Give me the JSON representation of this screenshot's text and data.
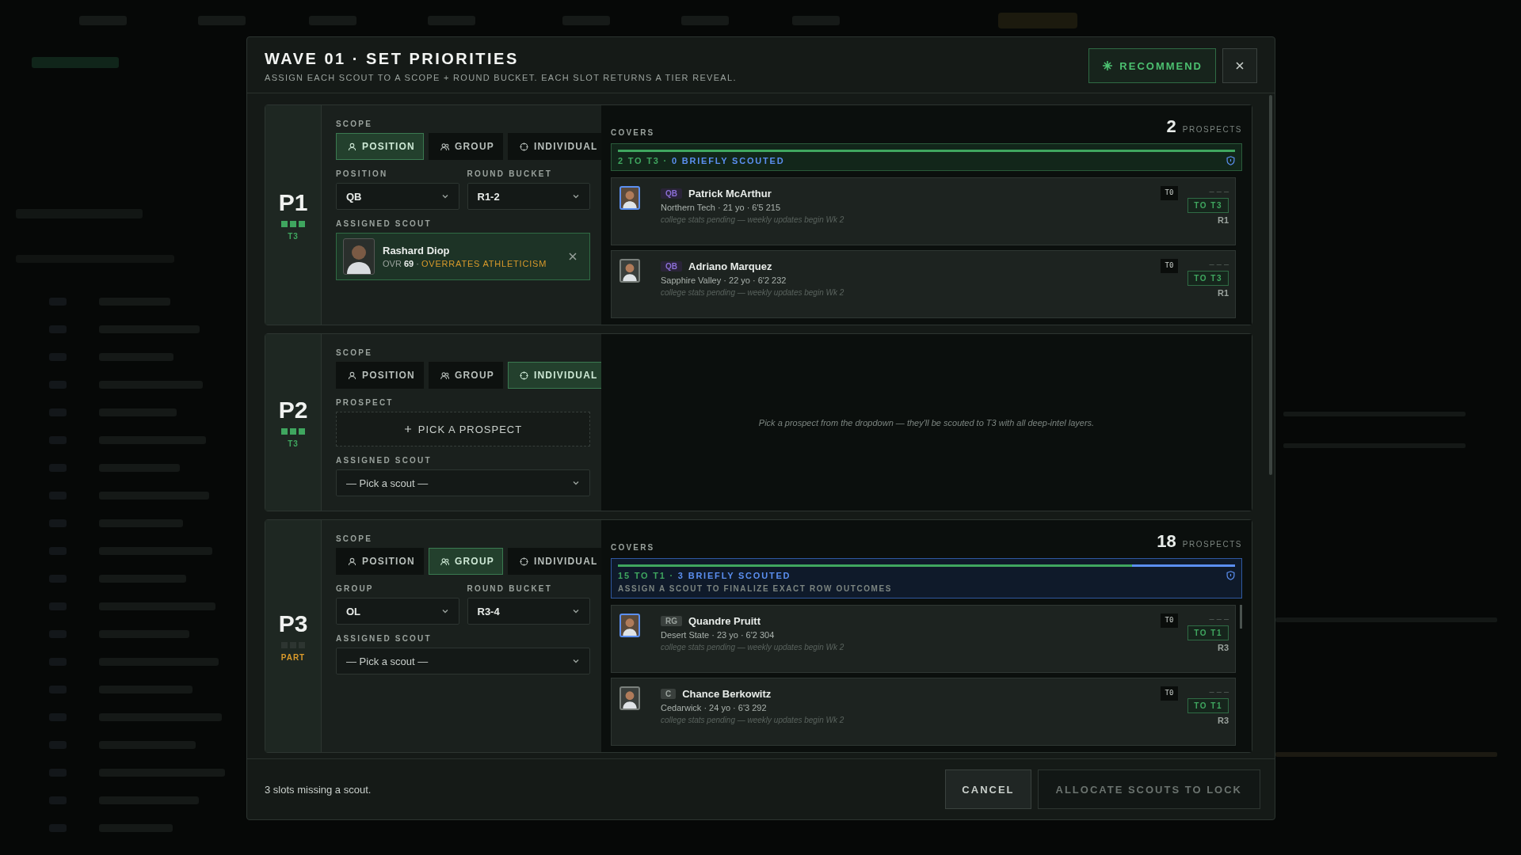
{
  "modal": {
    "sep": "·",
    "title": "WAVE 01 · SET PRIORITIES",
    "subtitle": "ASSIGN EACH SCOUT TO A SCOPE + ROUND BUCKET. EACH SLOT RETURNS A TIER REVEAL.",
    "recommend": "RECOMMEND",
    "slots": [
      {
        "label": "P1",
        "tier": "T3",
        "kind": "full",
        "scope_label": "SCOPE",
        "scopes": [
          {
            "label": "POSITION",
            "kind": "position",
            "selected": true
          },
          {
            "label": "GROUP",
            "kind": "group",
            "selected": false
          },
          {
            "label": "INDIVIDUAL",
            "kind": "individual",
            "selected": false
          }
        ],
        "fields": [
          {
            "label": "POSITION",
            "value": "QB"
          },
          {
            "label": "ROUND BUCKET",
            "value": "R1-2"
          }
        ],
        "scout": {
          "label": "ASSIGNED SCOUT",
          "name": "Rashard Diop",
          "ovr_label": "OVR",
          "ovr": "69",
          "trait": "OVERRATES ATHLETICISM"
        },
        "covers": {
          "label": "COVERS",
          "count": "2",
          "unit": "PROSPECTS",
          "kind": "complete",
          "level": 1,
          "reveal": "2 TO T3",
          "brief": "0 BRIEFLY SCOUTED",
          "prospects": [
            {
              "pos": "QB",
              "color": "#8b6fd6",
              "name": "Patrick McArthur",
              "meta": "Northern Tech · 21 yo · 6'5 215",
              "note": "college stats pending — weekly updates begin Wk 2",
              "tier": "T0",
              "dashes": "– – –",
              "reveal": "TO T3",
              "round": "R1"
            },
            {
              "pos": "QB",
              "color": "#8b6fd6",
              "name": "Adriano Marquez",
              "meta": "Sapphire Valley · 22 yo · 6'2 232",
              "note": "college stats pending — weekly updates begin Wk 2",
              "tier": "T0",
              "dashes": "– – –",
              "reveal": "TO T3",
              "round": "R1"
            }
          ]
        }
      },
      {
        "label": "P2",
        "tier": "T3",
        "kind": "full",
        "scope_label": "SCOPE",
        "scopes": [
          {
            "label": "POSITION",
            "kind": "position",
            "selected": false
          },
          {
            "label": "GROUP",
            "kind": "group",
            "selected": false
          },
          {
            "label": "INDIVIDUAL",
            "kind": "individual",
            "selected": true
          }
        ],
        "prospect": {
          "label": "PROSPECT",
          "action": "PICK A PROSPECT"
        },
        "scout": {
          "label": "ASSIGNED SCOUT",
          "placeholder": "— Pick a scout —"
        },
        "empty_note": "Pick a prospect from the dropdown — they'll be scouted to T3 with all deep-intel layers."
      },
      {
        "label": "P3",
        "tier": "PART",
        "kind": "part",
        "scope_label": "SCOPE",
        "scopes": [
          {
            "label": "POSITION",
            "kind": "position",
            "selected": false
          },
          {
            "label": "GROUP",
            "kind": "group",
            "selected": true
          },
          {
            "label": "INDIVIDUAL",
            "kind": "individual",
            "selected": false
          }
        ],
        "fields": [
          {
            "label": "GROUP",
            "value": "OL"
          },
          {
            "label": "ROUND BUCKET",
            "value": "R3-4"
          }
        ],
        "scout": {
          "label": "ASSIGNED SCOUT",
          "placeholder": "— Pick a scout —"
        },
        "covers": {
          "label": "COVERS",
          "count": "18",
          "unit": "PROSPECTS",
          "kind": "partial",
          "level": 0.833,
          "reveal": "15 TO T1",
          "brief": "3 BRIEFLY SCOUTED",
          "note": "ASSIGN A SCOUT TO FINALIZE EXACT ROW OUTCOMES",
          "prospects": [
            {
              "pos": "RG",
              "color": "#3a403d",
              "name": "Quandre Pruitt",
              "meta": "Desert State · 23 yo · 6'2 304",
              "note": "college stats pending — weekly updates begin Wk 2",
              "tier": "T0",
              "dashes": "– – –",
              "reveal": "TO T1",
              "round": "R3"
            },
            {
              "pos": "C",
              "color": "#3a403d",
              "name": "Chance Berkowitz",
              "meta": "Cedarwick · 24 yo · 6'3 292",
              "note": "college stats pending — weekly updates begin Wk 2",
              "tier": "T0",
              "dashes": "– – –",
              "reveal": "TO T1",
              "round": "R3"
            }
          ]
        }
      }
    ],
    "footer": {
      "status": "3 slots missing a scout.",
      "cancel": "CANCEL",
      "allocate": "ALLOCATE SCOUTS TO LOCK"
    }
  }
}
